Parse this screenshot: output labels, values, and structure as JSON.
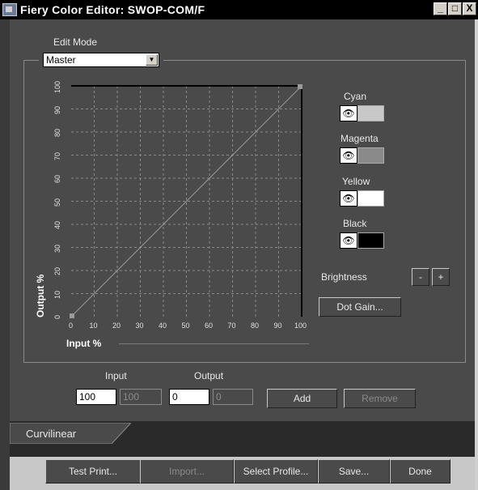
{
  "window": {
    "title": "Fiery Color Editor: SWOP-COM/F",
    "controls": [
      "_",
      "□",
      "X"
    ]
  },
  "edit_mode": {
    "label": "Edit Mode",
    "value": "Master"
  },
  "graph": {
    "y_label": "Output %",
    "x_label": "Input %",
    "x_ticks": [
      "0",
      "10",
      "20",
      "30",
      "40",
      "50",
      "60",
      "70",
      "80",
      "90",
      "100"
    ],
    "y_ticks": [
      "0",
      "10",
      "20",
      "30",
      "40",
      "50",
      "60",
      "70",
      "80",
      "90",
      "100"
    ],
    "curve": [
      [
        0,
        0
      ],
      [
        100,
        100
      ]
    ]
  },
  "channels": [
    {
      "name": "Cyan",
      "color": "#c8c8c8"
    },
    {
      "name": "Magenta",
      "color": "#8a8a8a"
    },
    {
      "name": "Yellow",
      "color": "#ffffff"
    },
    {
      "name": "Black",
      "color": "#000000"
    }
  ],
  "brightness": {
    "label": "Brightness",
    "minus": "-",
    "plus": "+"
  },
  "dot_gain_button": "Dot Gain...",
  "input_output": {
    "input_label": "Input",
    "output_label": "Output",
    "input_value": "100",
    "input_readonly": "100",
    "output_value": "0",
    "output_readonly": "0",
    "add_label": "Add",
    "remove_label": "Remove"
  },
  "tab": {
    "label": "Curvilinear"
  },
  "bottom_buttons": {
    "test_print": "Test Print...",
    "import": "Import...",
    "select_profile": "Select Profile...",
    "save": "Save...",
    "done": "Done"
  }
}
